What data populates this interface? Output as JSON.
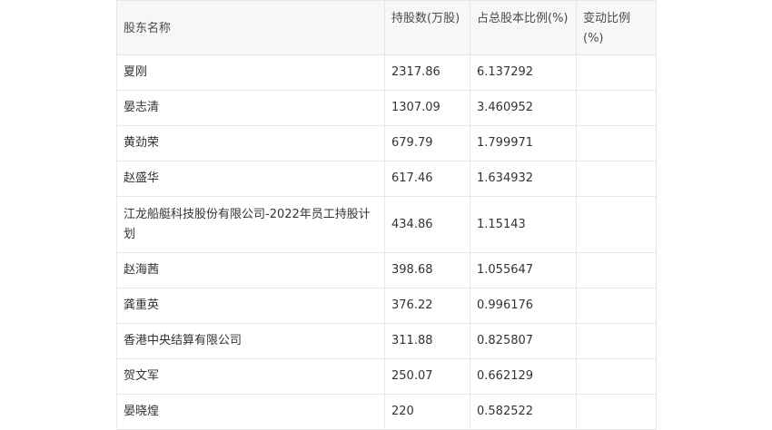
{
  "table": {
    "headers": [
      "股东名称",
      "持股数(万股)",
      "占总股本比例(%)",
      "变动比例(%)"
    ],
    "rows": [
      {
        "name": "夏刚",
        "shares": "2317.86",
        "ratio": "6.137292",
        "change": ""
      },
      {
        "name": "晏志清",
        "shares": "1307.09",
        "ratio": "3.460952",
        "change": ""
      },
      {
        "name": "黄劲荣",
        "shares": "679.79",
        "ratio": "1.799971",
        "change": ""
      },
      {
        "name": "赵盛华",
        "shares": "617.46",
        "ratio": "1.634932",
        "change": ""
      },
      {
        "name": "江龙船艇科技股份有限公司-2022年员工持股计划",
        "shares": "434.86",
        "ratio": "1.15143",
        "change": ""
      },
      {
        "name": "赵海茜",
        "shares": "398.68",
        "ratio": "1.055647",
        "change": ""
      },
      {
        "name": "龚重英",
        "shares": "376.22",
        "ratio": "0.996176",
        "change": ""
      },
      {
        "name": "香港中央结算有限公司",
        "shares": "311.88",
        "ratio": "0.825807",
        "change": ""
      },
      {
        "name": "贺文军",
        "shares": "250.07",
        "ratio": "0.662129",
        "change": ""
      },
      {
        "name": "晏晓煌",
        "shares": "220",
        "ratio": "0.582522",
        "change": ""
      }
    ]
  }
}
